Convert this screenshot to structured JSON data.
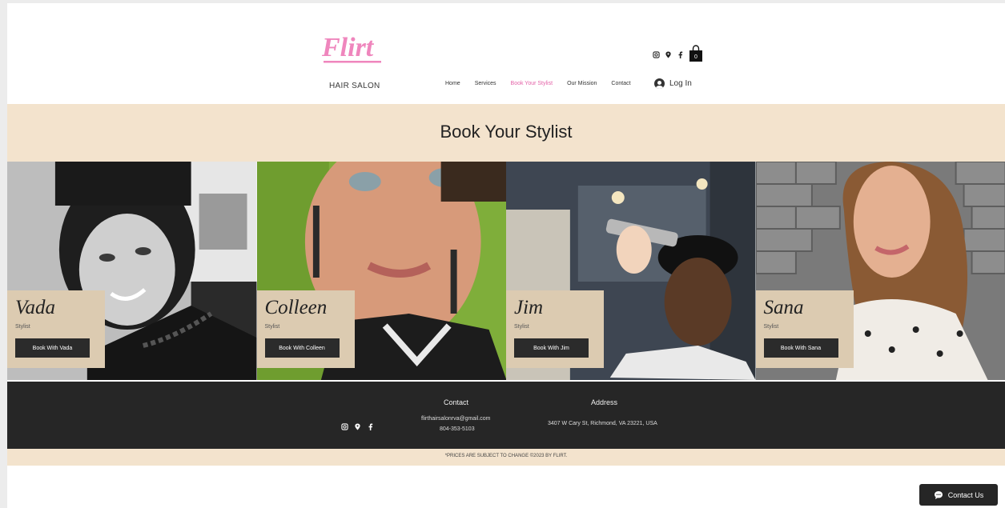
{
  "header": {
    "logo_text": "Flirt",
    "sub": "HAIR SALON",
    "nav": [
      {
        "label": "Home"
      },
      {
        "label": "Services"
      },
      {
        "label": "Book Your Stylist"
      },
      {
        "label": "Our Mission"
      },
      {
        "label": "Contact"
      }
    ],
    "login_label": "Log In",
    "cart_count": "0",
    "socials": [
      "instagram-icon",
      "location-pin-icon",
      "facebook-icon"
    ]
  },
  "page_title": "Book Your Stylist",
  "stylists": [
    {
      "name": "Vada",
      "role": "Stylist",
      "button": "Book With Vada"
    },
    {
      "name": "Colleen",
      "role": "Stylist",
      "button": "Book With Colleen"
    },
    {
      "name": "Jim",
      "role": "Stylist",
      "button": "Book With Jim"
    },
    {
      "name": "Sana",
      "role": "Stylist",
      "button": "Book With Sana"
    }
  ],
  "footer": {
    "contact_heading": "Contact",
    "email": "flirthairsalonrva@gmail.com",
    "phone": "804-353-5103",
    "address_heading": "Address",
    "address": "3407 W Cary St, Richmond, VA 23221, USA",
    "disclaimer": "*PRICES ARE SUBJECT TO CHANGE ©2023 BY FLIRT."
  },
  "chat": {
    "label": "Contact Us"
  },
  "colors": {
    "accent_pink": "#e463a8",
    "band_beige": "#f3e3cd",
    "card_beige": "#dccbb1",
    "dark": "#262626"
  }
}
